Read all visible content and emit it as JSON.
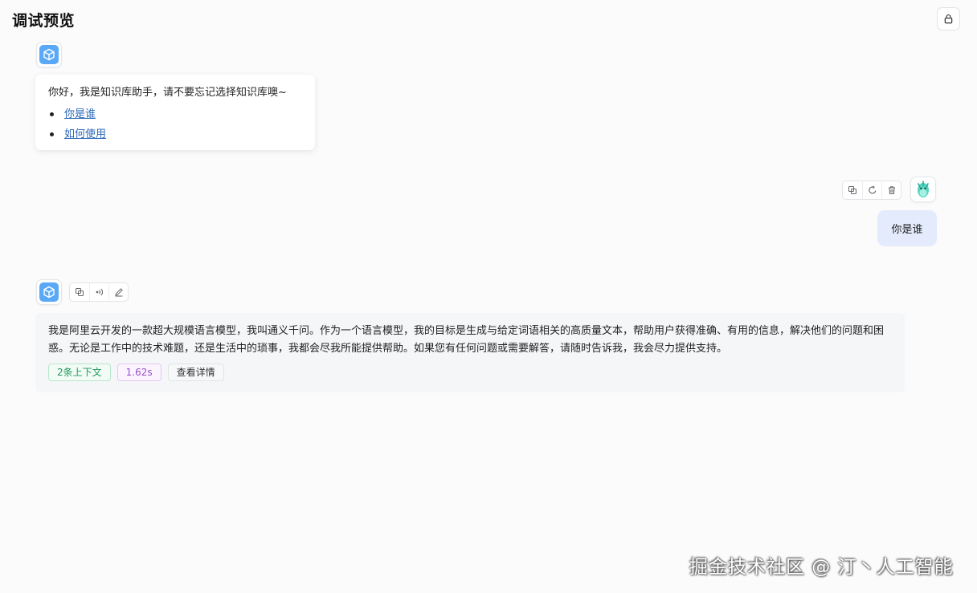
{
  "header": {
    "title": "调试预览",
    "action_icon": "lock-icon"
  },
  "welcome": {
    "greeting": "你好，我是知识库助手，请不要忘记选择知识库噢~",
    "links": [
      "你是谁",
      "如何使用"
    ]
  },
  "user_message": {
    "text": "你是谁",
    "actions": [
      "copy-icon",
      "retry-icon",
      "delete-icon"
    ]
  },
  "ai_message": {
    "actions": [
      "copy-icon",
      "speaker-icon",
      "edit-icon"
    ],
    "text": "我是阿里云开发的一款超大规模语言模型，我叫通义千问。作为一个语言模型，我的目标是生成与给定词语相关的高质量文本，帮助用户获得准确、有用的信息，解决他们的问题和困惑。无论是工作中的技术难题，还是生活中的琐事，我都会尽我所能提供帮助。如果您有任何问题或需要解答，请随时告诉我，我会尽力提供支持。",
    "tags": {
      "context": "2条上下文",
      "time": "1.62s",
      "detail": "查看详情"
    }
  },
  "watermark": "掘金技术社区 @ 汀丶人工智能",
  "colors": {
    "accent": "#5aa9f7",
    "user_bubble": "#e4ebfd",
    "link": "#2a67b8"
  }
}
